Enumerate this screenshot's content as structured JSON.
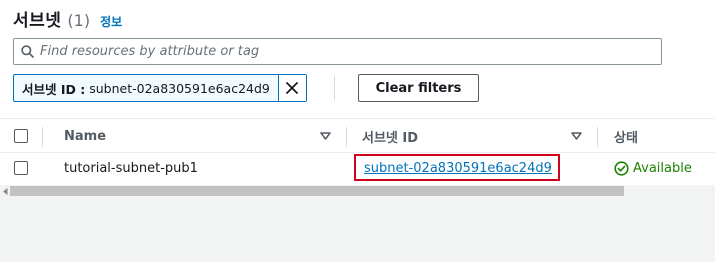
{
  "header": {
    "title": "서브넷",
    "count": "(1)",
    "info_label": "정보"
  },
  "search": {
    "placeholder": "Find resources by attribute or tag",
    "value": ""
  },
  "filter_token": {
    "key": "서브넷 ID :",
    "value": "subnet-02a830591e6ac24d9"
  },
  "clear_filters_label": "Clear filters",
  "table": {
    "columns": [
      "Name",
      "서브넷 ID",
      "상태"
    ],
    "rows": [
      {
        "name": "tutorial-subnet-pub1",
        "subnet_id": "subnet-02a830591e6ac24d9",
        "status": "Available"
      }
    ]
  },
  "colors": {
    "link": "#0073bb",
    "available": "#1d8102",
    "highlight": "#d0021b"
  }
}
